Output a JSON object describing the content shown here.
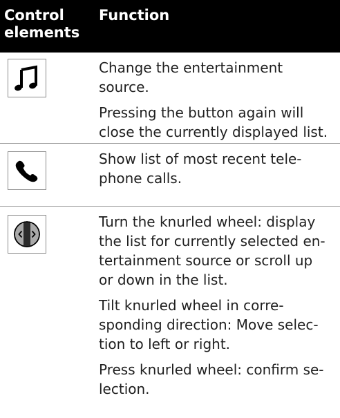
{
  "header": {
    "col1_line1": "Control",
    "col1_line2": "elements",
    "col2": "Function"
  },
  "rows": [
    {
      "icon": "music-note-icon",
      "paragraphs": [
        [
          "Change the entertainment",
          "source."
        ],
        [
          "Pressing the button again will",
          "close the currently displayed list."
        ]
      ]
    },
    {
      "icon": "telephone-handset-icon",
      "paragraphs": [
        [
          "Show list of most recent tele-",
          "phone calls."
        ]
      ]
    },
    {
      "icon": "knurled-wheel-icon",
      "paragraphs": [
        [
          "Turn the knurled wheel: display",
          "the list for currently selected en-",
          "tertainment source or scroll up",
          "or down in the list."
        ],
        [
          "Tilt knurled wheel in corre-",
          "sponding direction: Move selec-",
          "tion to left or right."
        ],
        [
          "Press knurled wheel: confirm se-",
          "lection."
        ]
      ]
    }
  ],
  "colors": {
    "header_bg": "#000000",
    "header_text": "#ffffff",
    "divider": "#9a9a9a",
    "body_text": "#1f1f1f"
  }
}
